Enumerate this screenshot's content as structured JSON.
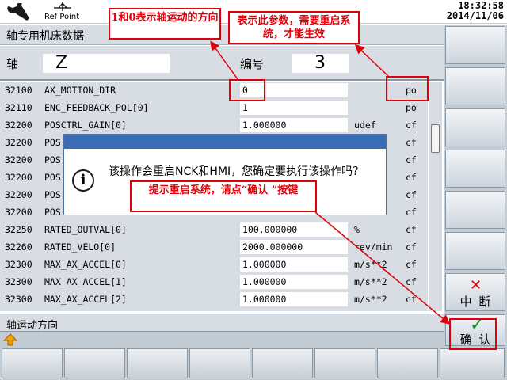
{
  "header": {
    "refpoint_label": "Ref Point",
    "time": "18:32:58",
    "date": "2014/11/06"
  },
  "window_title": "轴专用机床数据",
  "axis": {
    "label": "轴",
    "value": "Z",
    "number_label": "编号",
    "number": "3"
  },
  "rows": [
    {
      "num": "32100",
      "name": "AX_MOTION_DIR",
      "value": "0",
      "unit": "",
      "type": "po"
    },
    {
      "num": "32110",
      "name": "ENC_FEEDBACK_POL[0]",
      "value": "1",
      "unit": "",
      "type": "po"
    },
    {
      "num": "32200",
      "name": "POSCTRL_GAIN[0]",
      "value": "1.000000",
      "unit": "udef",
      "type": "cf"
    },
    {
      "num": "32200",
      "name": "POS",
      "value": "",
      "unit": "",
      "type": "cf"
    },
    {
      "num": "32200",
      "name": "POS",
      "value": "",
      "unit": "",
      "type": "cf"
    },
    {
      "num": "32200",
      "name": "POS",
      "value": "",
      "unit": "",
      "type": "cf"
    },
    {
      "num": "32200",
      "name": "POS",
      "value": "",
      "unit": "",
      "type": "cf"
    },
    {
      "num": "32200",
      "name": "POS",
      "value": "",
      "unit": "",
      "type": "cf"
    },
    {
      "num": "32250",
      "name": "RATED_OUTVAL[0]",
      "value": "100.000000",
      "unit": "%",
      "type": "cf"
    },
    {
      "num": "32260",
      "name": "RATED_VELO[0]",
      "value": "2000.000000",
      "unit": "rev/min",
      "type": "cf"
    },
    {
      "num": "32300",
      "name": "MAX_AX_ACCEL[0]",
      "value": "1.000000",
      "unit": "m/s**2",
      "type": "cf"
    },
    {
      "num": "32300",
      "name": "MAX_AX_ACCEL[1]",
      "value": "1.000000",
      "unit": "m/s**2",
      "type": "cf"
    },
    {
      "num": "32300",
      "name": "MAX_AX_ACCEL[2]",
      "value": "1.000000",
      "unit": "m/s**2",
      "type": "cf"
    }
  ],
  "status_text": "轴运动方向",
  "softkeys": {
    "interrupt": "中 断",
    "confirm": "确 认"
  },
  "dialog": {
    "message": "该操作会重启NCK和HMI，您确定要执行该操作吗？"
  },
  "annotations": {
    "direction": "1和0表示轴运动的方向",
    "restart_param": "表示此参数，需要重启系统，才能生效",
    "confirm_hint": "提示重启系统，请点“确认 ”按键"
  },
  "colors": {
    "accent": "#3a6bb5",
    "annotation": "#e0000c",
    "confirm_check": "#0a9a2a",
    "interrupt_x": "#c8000a"
  }
}
